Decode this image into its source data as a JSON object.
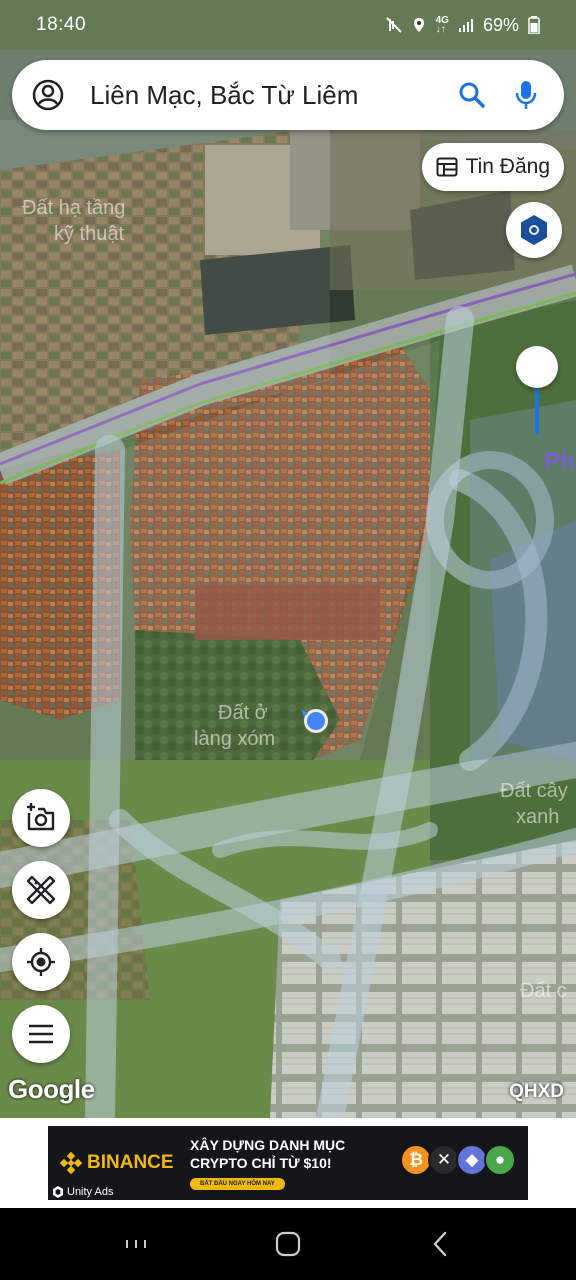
{
  "status_bar": {
    "time": "18:40",
    "battery": "69%",
    "icons": [
      "mute-icon",
      "location-icon",
      "4g-icon",
      "signal-icon",
      "battery-icon"
    ]
  },
  "search": {
    "query": "Liên Mạc, Bắc Từ Liêm",
    "icons": [
      "account-icon",
      "search-icon",
      "mic-icon"
    ]
  },
  "chip": {
    "label": "Tin Đăng",
    "icon": "listing-icon"
  },
  "map": {
    "overlay_labels": [
      "Đất hạ tầng",
      "kỹ thuật",
      "Đất ở",
      "làng xóm",
      "Đất cây",
      "xanh",
      "Đất c",
      "Ph"
    ],
    "google_logo": "Google",
    "code": "QHXD",
    "colors": {
      "accent": "#1a73e8",
      "location_dot": "#4285f4",
      "layers_icon": "#1a4f9c"
    }
  },
  "tools": {
    "icons": [
      "add-photo-icon",
      "measure-icon",
      "my-location-icon",
      "menu-icon"
    ]
  },
  "ad": {
    "brand": "BINANCE",
    "headline_line1": "XÂY DỰNG DANH MỤC",
    "headline_line2": "CRYPTO CHỈ TỪ $10!",
    "cta": "BẮT ĐẦU NGAY HÔM NAY",
    "network": "Unity Ads",
    "brand_color": "#f0b90b"
  },
  "nav": {
    "icons": [
      "recents-icon",
      "home-icon",
      "back-icon"
    ]
  }
}
